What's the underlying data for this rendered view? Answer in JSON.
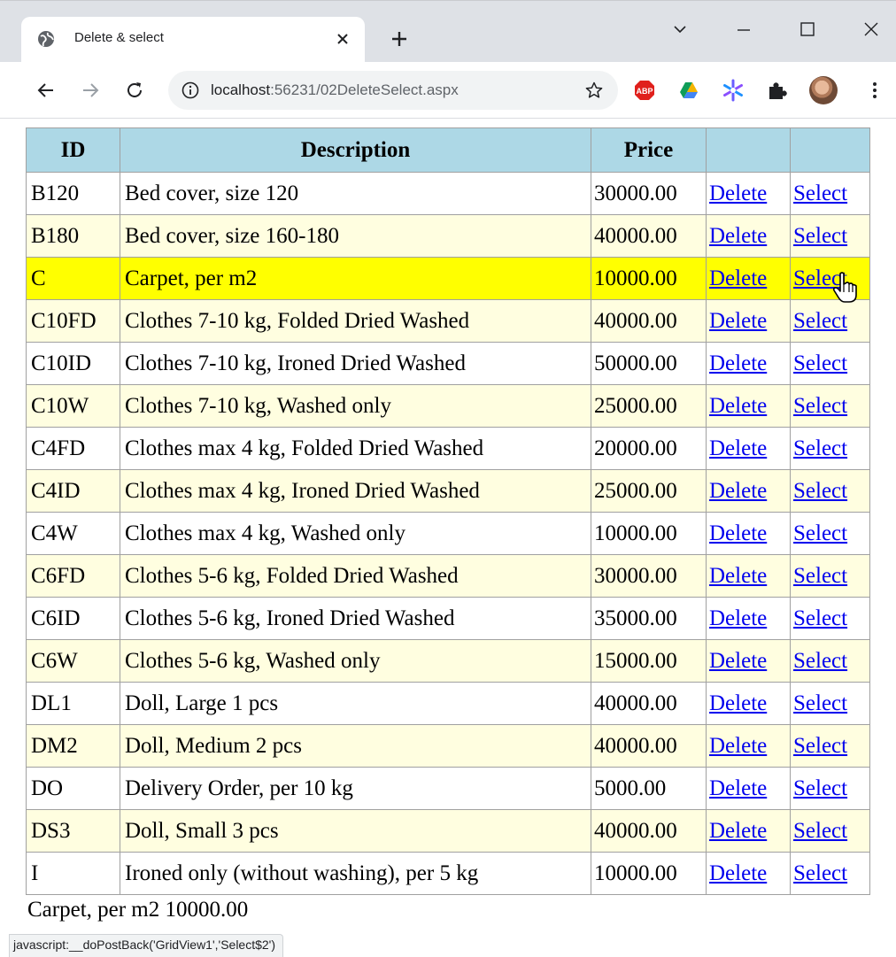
{
  "browser": {
    "tab_title": "Delete & select",
    "url_host": "localhost",
    "url_rest": ":56231/02DeleteSelect.aspx",
    "status_text": "javascript:__doPostBack('GridView1','Select$2')"
  },
  "icons": {
    "back": "arrow-left",
    "forward": "arrow-right",
    "reload": "reload",
    "info": "info-circle",
    "bookmark": "star-outline",
    "extensions": [
      "adblock-plus",
      "google-drive",
      "colorful-snowflake",
      "puzzle"
    ],
    "menu": "vertical-ellipsis"
  },
  "colors": {
    "header_bg": "#add8e6",
    "alt_row_bg": "#fffee0",
    "selected_row_bg": "#ffff00",
    "link": "#0000ee"
  },
  "grid": {
    "headers": {
      "id": "ID",
      "description": "Description",
      "price": "Price",
      "delete": "",
      "select": ""
    },
    "delete_label": "Delete",
    "select_label": "Select",
    "selected_index": 2,
    "rows": [
      {
        "id": "B120",
        "description": "Bed cover, size 120",
        "price": "30000.00"
      },
      {
        "id": "B180",
        "description": "Bed cover, size 160-180",
        "price": "40000.00"
      },
      {
        "id": "C",
        "description": "Carpet, per m2",
        "price": "10000.00"
      },
      {
        "id": "C10FD",
        "description": "Clothes 7-10 kg, Folded Dried Washed",
        "price": "40000.00"
      },
      {
        "id": "C10ID",
        "description": "Clothes 7-10 kg, Ironed Dried Washed",
        "price": "50000.00"
      },
      {
        "id": "C10W",
        "description": "Clothes 7-10 kg, Washed only",
        "price": "25000.00"
      },
      {
        "id": "C4FD",
        "description": "Clothes max 4 kg, Folded Dried Washed",
        "price": "20000.00"
      },
      {
        "id": "C4ID",
        "description": "Clothes max 4 kg, Ironed Dried Washed",
        "price": "25000.00"
      },
      {
        "id": "C4W",
        "description": "Clothes max 4 kg, Washed only",
        "price": "10000.00"
      },
      {
        "id": "C6FD",
        "description": "Clothes 5-6 kg, Folded Dried Washed",
        "price": "30000.00"
      },
      {
        "id": "C6ID",
        "description": "Clothes 5-6 kg, Ironed Dried Washed",
        "price": "35000.00"
      },
      {
        "id": "C6W",
        "description": "Clothes 5-6 kg, Washed only",
        "price": "15000.00"
      },
      {
        "id": "DL1",
        "description": "Doll, Large 1 pcs",
        "price": "40000.00"
      },
      {
        "id": "DM2",
        "description": "Doll, Medium 2 pcs",
        "price": "40000.00"
      },
      {
        "id": "DO",
        "description": "Delivery Order, per 10 kg",
        "price": "5000.00"
      },
      {
        "id": "DS3",
        "description": "Doll, Small 3 pcs",
        "price": "40000.00"
      },
      {
        "id": "I",
        "description": "Ironed only (without washing), per 5 kg",
        "price": "10000.00"
      }
    ]
  },
  "selection_summary": "Carpet, per m2 10000.00"
}
